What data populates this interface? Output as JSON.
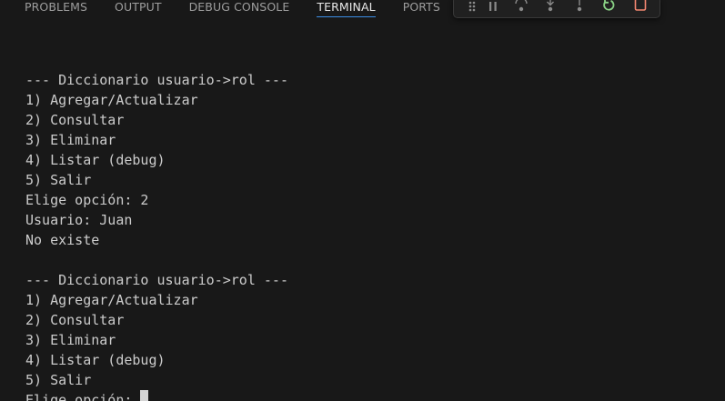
{
  "panel_tabs": [
    {
      "label": "PROBLEMS",
      "active": false
    },
    {
      "label": "OUTPUT",
      "active": false
    },
    {
      "label": "DEBUG CONSOLE",
      "active": false
    },
    {
      "label": "TERMINAL",
      "active": true
    },
    {
      "label": "PORTS",
      "active": false
    }
  ],
  "debug_toolbar": [
    {
      "icon": "drag-handle-icon"
    },
    {
      "icon": "pause-icon"
    },
    {
      "icon": "step-over-icon"
    },
    {
      "icon": "step-into-icon"
    },
    {
      "icon": "step-out-icon"
    },
    {
      "icon": "restart-icon",
      "color": "#89d185"
    },
    {
      "icon": "stop-icon",
      "color": "#f48771"
    }
  ],
  "terminal": {
    "lines": [
      "",
      "--- Diccionario usuario->rol ---",
      "1) Agregar/Actualizar",
      "2) Consultar",
      "3) Eliminar",
      "4) Listar (debug)",
      "5) Salir",
      "Elige opción: 2",
      "Usuario: Juan",
      "No existe",
      "",
      "--- Diccionario usuario->rol ---",
      "1) Agregar/Actualizar",
      "2) Consultar",
      "3) Eliminar",
      "4) Listar (debug)",
      "5) Salir"
    ],
    "prompt": "Elige opción: "
  },
  "colors": {
    "background": "#181818",
    "tab_active": "#e7e7e7",
    "tab_inactive": "#9d9d9d",
    "tab_underline": "#3b8ee6",
    "terminal_text": "#cccccc"
  }
}
